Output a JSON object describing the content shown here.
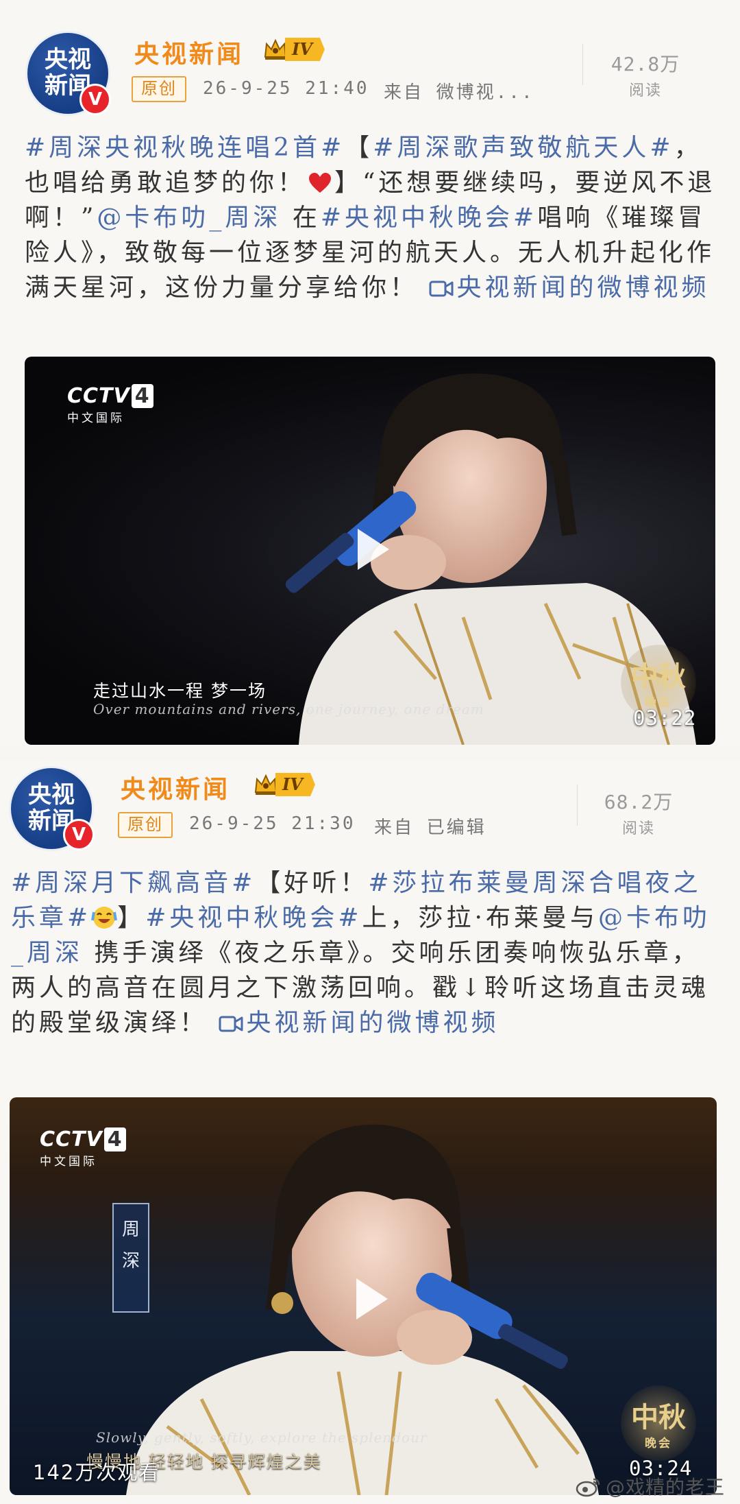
{
  "posts": [
    {
      "author": "央视新闻",
      "avatar_line1": "央视",
      "avatar_line2": "新闻",
      "verified": "V",
      "level": "IV",
      "original_tag": "原创",
      "time": "26-9-25 21:40",
      "source": "来自  微博视...",
      "reads_count": "42.8万",
      "reads_label": "阅读",
      "text": {
        "t1": "#周深央视秋晚连唱2首#",
        "t2": "【",
        "t3": "#周深歌声致敬航天人#",
        "t4": "，也唱给勇敢追梦的你！",
        "t5": "】“还想要继续吗，要逆风不退啊！”",
        "t6": "@卡布叻_周深",
        "t7": " 在",
        "t8": "#央视中秋晚会#",
        "t9": "唱响《璀璨冒险人》，致敬每一位逐梦星河的航天人。无人机升起化作满天星河，这份力量分享给你！ ",
        "t10": "央视新闻的微博视频"
      },
      "video": {
        "channel": "CCTV",
        "channel_num": "4",
        "channel_sub": "中文国际",
        "subtitle_zh": "走过山水一程  梦一场",
        "subtitle_en": "Over mountains and rivers, one journey, one dream",
        "gala_top": "中秋",
        "gala_bottom": "晚会",
        "duration": "03:22"
      }
    },
    {
      "author": "央视新闻",
      "avatar_line1": "央视",
      "avatar_line2": "新闻",
      "verified": "V",
      "level": "IV",
      "original_tag": "原创",
      "time": "26-9-25 21:30",
      "source": "来自   已编辑",
      "reads_count": "68.2万",
      "reads_label": "阅读",
      "text": {
        "t1": "#周深月下飙高音#",
        "t2": "【好听！",
        "t3": "#莎拉布莱曼周深合唱夜之乐章#",
        "t4": "】",
        "t5": "#央视中秋晚会#",
        "t6": "上，莎拉·布莱曼与",
        "t7": "@卡布叻_周深",
        "t8": " 携手演绎《夜之乐章》。交响乐团奏响恢弘乐章，两人的高音在圆月之下激荡回响。戳↓聆听这场直击灵魂的殿堂级演绎！ ",
        "t9": "央视新闻的微博视频"
      },
      "video": {
        "channel": "CCTV",
        "channel_num": "4",
        "channel_sub": "中文国际",
        "name_banner": "周深",
        "subtitle_en": "Slowly, gently, softly, explore the splendour",
        "subtitle_zh": "慢慢地  轻轻地  探寻辉煌之美",
        "gala_top": "中秋",
        "gala_bottom": "晚会",
        "views": "142万次观看",
        "duration": "03:24"
      }
    }
  ],
  "watermark": "@戏精的老王",
  "colors": {
    "author": "#f08a1a",
    "link": "#4a6aa8",
    "badge": "#f6b722",
    "verified": "#e8242b"
  },
  "icons": [
    "crown-icon",
    "heart-icon",
    "video-camera-icon",
    "play-icon",
    "weibo-icon",
    "laugh-emoji-icon"
  ]
}
